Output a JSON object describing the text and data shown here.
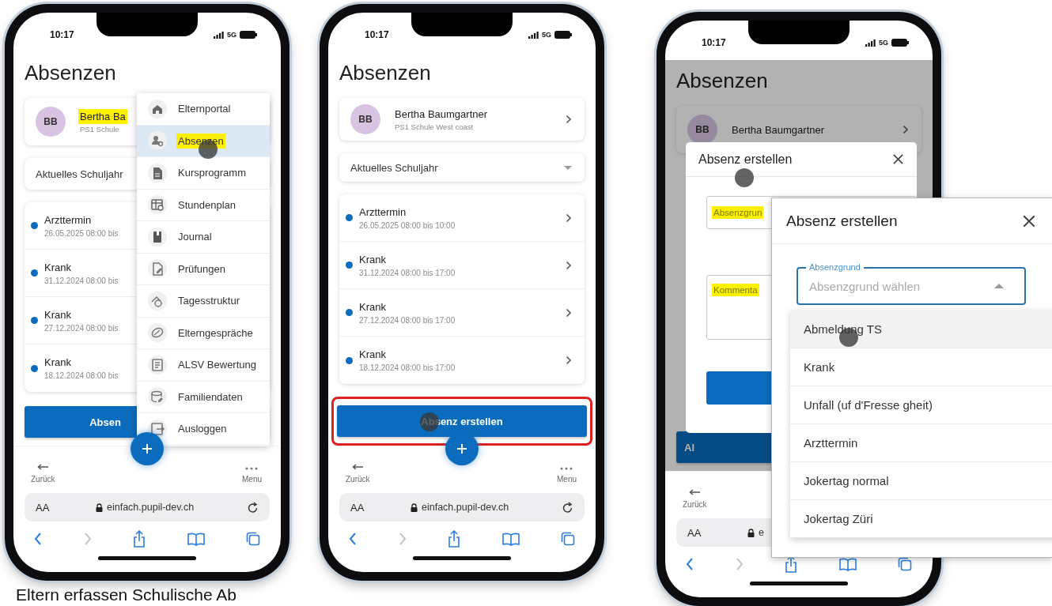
{
  "phones": [
    {
      "status": {
        "time": "10:17",
        "network": "5G"
      },
      "title": "Absenzen",
      "student": {
        "initials": "BB",
        "name": "Bertha Ba",
        "school": "PS1 Schule",
        "highlighted": true
      },
      "school_year": {
        "value": "Aktuelles Schuljahr"
      },
      "absences": [
        {
          "reason": "Arzttermin",
          "period": "26.05.2025 08:00 bis"
        },
        {
          "reason": "Krank",
          "period": "31.12.2024 08:00 bis"
        },
        {
          "reason": "Krank",
          "period": "27.12.2024 08:00 bis"
        },
        {
          "reason": "Krank",
          "period": "18.12.2024 08:00 bis"
        }
      ],
      "create_button": {
        "label": "Absen",
        "annotated": false,
        "touch": false
      },
      "menu": {
        "items": [
          {
            "label": "Elternportal",
            "selected": false,
            "highlighted": false,
            "touch": false
          },
          {
            "label": "Absenzen",
            "selected": true,
            "highlighted": true,
            "touch": true
          },
          {
            "label": "Kursprogramm",
            "selected": false,
            "highlighted": false,
            "touch": false
          },
          {
            "label": "Stundenplan",
            "selected": false,
            "highlighted": false,
            "touch": false
          },
          {
            "label": "Journal",
            "selected": false,
            "highlighted": false,
            "touch": false
          },
          {
            "label": "Prüfungen",
            "selected": false,
            "highlighted": false,
            "touch": false
          },
          {
            "label": "Tagesstruktur",
            "selected": false,
            "highlighted": false,
            "touch": false
          },
          {
            "label": "Elterngespräche",
            "selected": false,
            "highlighted": false,
            "touch": false
          },
          {
            "label": "ALSV Bewertung",
            "selected": false,
            "highlighted": false,
            "touch": false
          },
          {
            "label": "Familiendaten",
            "selected": false,
            "highlighted": false,
            "touch": false
          },
          {
            "label": "Ausloggen",
            "selected": false,
            "highlighted": false,
            "touch": false
          }
        ]
      },
      "bottom_nav": {
        "back": "Zurück",
        "menu": "Menu"
      },
      "browser": {
        "text_size": "AA",
        "url": "einfach.pupil-dev.ch"
      }
    },
    {
      "status": {
        "time": "10:17",
        "network": "5G"
      },
      "title": "Absenzen",
      "student": {
        "initials": "BB",
        "name": "Bertha Baumgartner",
        "school": "PS1 Schule West coast",
        "highlighted": false
      },
      "school_year": {
        "value": "Aktuelles Schuljahr"
      },
      "absences": [
        {
          "reason": "Arzttermin",
          "period": "26.05.2025 08:00 bis 10:00"
        },
        {
          "reason": "Krank",
          "period": "31.12.2024 08:00 bis 17:00"
        },
        {
          "reason": "Krank",
          "period": "27.12.2024 08:00 bis 17:00"
        },
        {
          "reason": "Krank",
          "period": "18.12.2024 08:00 bis 17:00"
        }
      ],
      "create_button": {
        "label": "Absenz erstellen",
        "annotated": true,
        "touch": true
      },
      "bottom_nav": {
        "back": "Zurück",
        "menu": "Menu"
      },
      "browser": {
        "text_size": "AA",
        "url": "einfach.pupil-dev.ch"
      }
    },
    {
      "status": {
        "time": "10:17",
        "network": "5G"
      },
      "title": "Absenzen",
      "student": {
        "initials": "BB",
        "name": "Bertha Baumgartner",
        "highlighted": false
      },
      "create_button": {
        "label": "Al",
        "annotated": false,
        "touch": false
      },
      "dialog": {
        "title": "Absenz erstellen",
        "touch": true,
        "fields": [
          {
            "kind": "select",
            "label": "Absenzgrun",
            "highlighted": true
          },
          {
            "kind": "textarea",
            "label": "Kommenta",
            "highlighted": true
          }
        ]
      },
      "bottom_nav": {
        "back": "Zurück"
      },
      "browser": {
        "text_size": "AA",
        "url": "e"
      }
    }
  ],
  "inset": {
    "title": "Absenz erstellen",
    "field": {
      "label": "Absenzgrund",
      "placeholder": "Absenzgrund wählen",
      "expanded": true
    },
    "options": [
      {
        "label": "Abmeldung TS",
        "highlighted": true,
        "touch": true
      },
      {
        "label": "Krank",
        "highlighted": false,
        "touch": false
      },
      {
        "label": "Unfall (uf d'Fresse gheit)",
        "highlighted": false,
        "touch": false
      },
      {
        "label": "Arzttermin",
        "highlighted": false,
        "touch": false
      },
      {
        "label": "Jokertag normal",
        "highlighted": false,
        "touch": false
      },
      {
        "label": "Jokertag Züri",
        "highlighted": false,
        "touch": false
      }
    ]
  },
  "caption": "Eltern erfassen Schulische Ab"
}
